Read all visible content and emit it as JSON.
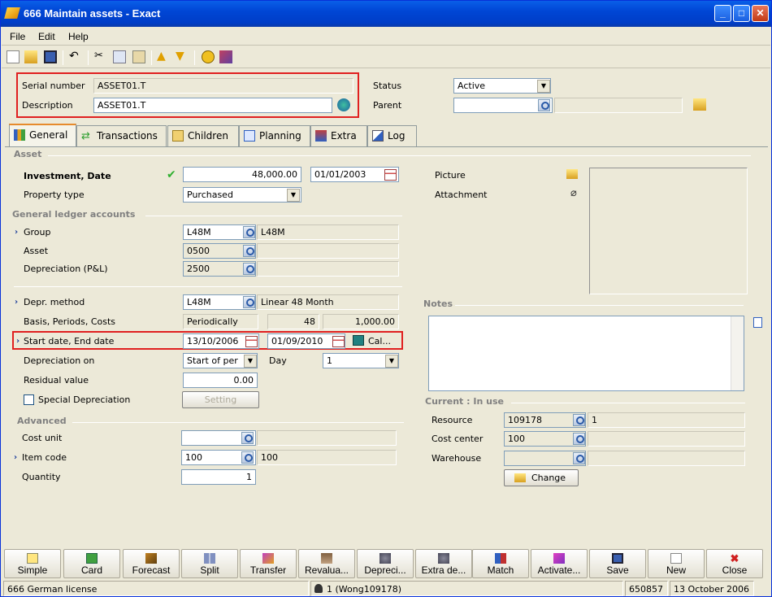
{
  "window": {
    "title": "666 Maintain assets - Exact"
  },
  "menu": {
    "file": "File",
    "edit": "Edit",
    "help": "Help"
  },
  "header": {
    "serial_label": "Serial number",
    "serial_value": "ASSET01.T",
    "desc_label": "Description",
    "desc_value": "ASSET01.T",
    "status_label": "Status",
    "status_value": "Active",
    "parent_label": "Parent",
    "parent_value": ""
  },
  "tabs": [
    "General",
    "Transactions",
    "Children",
    "Planning",
    "Extra",
    "Log"
  ],
  "asset": {
    "section": "Asset",
    "investment_label": "Investment, Date",
    "investment_value": "48,000.00",
    "investment_date": "01/01/2003",
    "property_label": "Property type",
    "property_value": "Purchased"
  },
  "gl": {
    "section": "General ledger accounts",
    "group_label": "Group",
    "group_code": "L48M",
    "group_desc": "L48M",
    "asset_label": "Asset",
    "asset_code": "0500",
    "asset_desc": "",
    "depr_label": "Depreciation (P&L)",
    "depr_code": "2500",
    "depr_desc": ""
  },
  "depr": {
    "method_label": "Depr. method",
    "method_code": "L48M",
    "method_desc": "Linear 48 Month",
    "basis_label": "Basis, Periods, Costs",
    "basis_value": "Periodically",
    "periods_value": "48",
    "costs_value": "1,000.00",
    "dates_label": "Start date, End date",
    "start_date": "13/10/2006",
    "end_date": "01/09/2010",
    "cal_label": "Cal...",
    "on_label": "Depreciation on",
    "on_value": "Start of per",
    "day_label": "Day",
    "day_value": "1",
    "residual_label": "Residual value",
    "residual_value": "0.00",
    "special_label": "Special Depreciation",
    "setting_label": "Setting"
  },
  "advanced": {
    "section": "Advanced",
    "cost_unit_label": "Cost unit",
    "cost_unit_value": "",
    "item_label": "Item code",
    "item_code": "100",
    "item_desc": "100",
    "qty_label": "Quantity",
    "qty_value": "1"
  },
  "right": {
    "picture_label": "Picture",
    "attachment_label": "Attachment",
    "notes_section": "Notes",
    "notes_value": "",
    "current_section": "Current : In use",
    "resource_label": "Resource",
    "resource_code": "109178",
    "resource_desc": "1",
    "cost_center_label": "Cost center",
    "cost_center_code": "100",
    "cost_center_desc": "",
    "warehouse_label": "Warehouse",
    "warehouse_code": "",
    "warehouse_desc": "",
    "change_label": "Change"
  },
  "buttons": [
    "Simple",
    "Card",
    "Forecast",
    "Split",
    "Transfer",
    "Revalua...",
    "Depreci...",
    "Extra de...",
    "Match",
    "Activate...",
    "Save",
    "New",
    "Close"
  ],
  "status": {
    "license": "666 German license",
    "user": "1 (Wong109178)",
    "number": "650857",
    "date": "13 October 2006"
  }
}
